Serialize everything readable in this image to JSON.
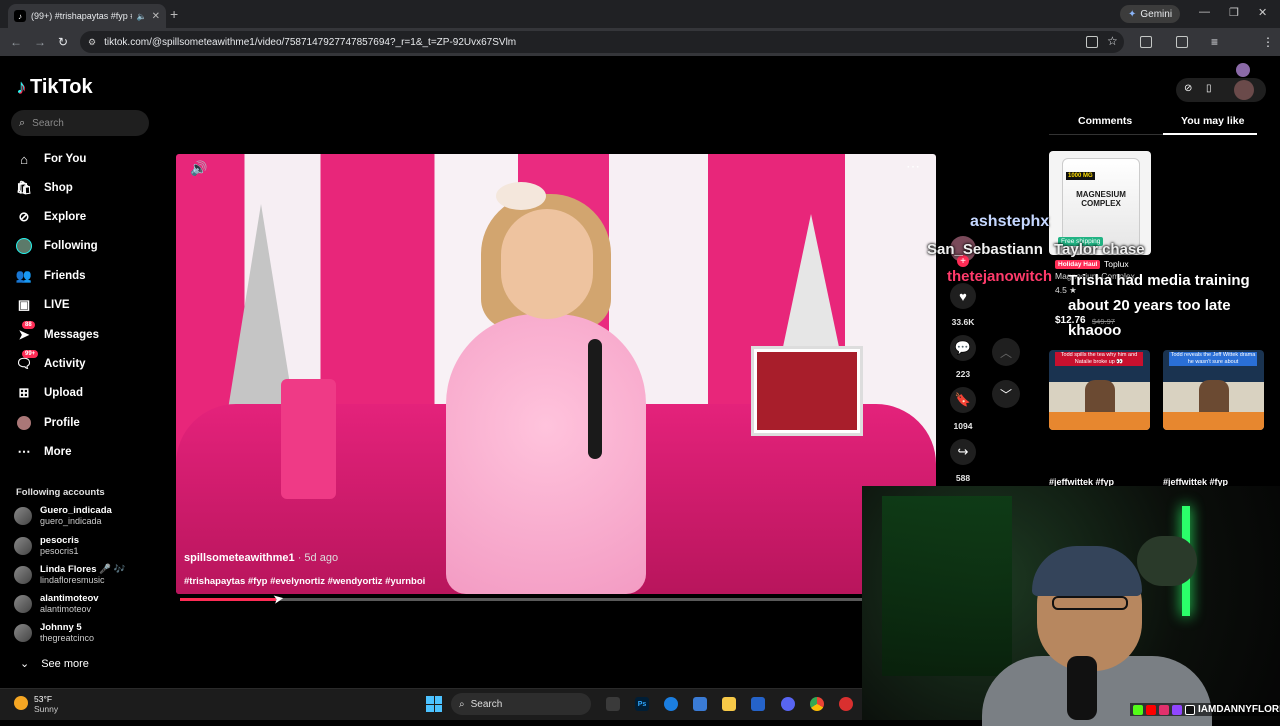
{
  "browser": {
    "tab_title": "(99+) #trishapaytas #fyp #e…",
    "new_tab": "+",
    "gemini_label": "Gemini",
    "url": "tiktok.com/@spillsometeawithme1/video/7587147927747857694?_r=1&_t=ZP-92Uvx67SVlm"
  },
  "sidebar": {
    "logo": "TikTok",
    "search_placeholder": "Search",
    "nav": [
      {
        "label": "For You",
        "icon": "home-icon"
      },
      {
        "label": "Shop",
        "icon": "shop-icon"
      },
      {
        "label": "Explore",
        "icon": "compass-icon"
      },
      {
        "label": "Following",
        "icon": "following-icon"
      },
      {
        "label": "Friends",
        "icon": "friends-icon"
      },
      {
        "label": "LIVE",
        "icon": "live-icon"
      },
      {
        "label": "Messages",
        "icon": "messages-icon",
        "badge": "88"
      },
      {
        "label": "Activity",
        "icon": "activity-icon",
        "badge": "99+"
      },
      {
        "label": "Upload",
        "icon": "upload-icon"
      },
      {
        "label": "Profile",
        "icon": "profile-icon"
      },
      {
        "label": "More",
        "icon": "more-icon"
      }
    ],
    "following_title": "Following accounts",
    "accounts": [
      {
        "name": "Guero_indicada",
        "handle": "guero_indicada"
      },
      {
        "name": "pesocris",
        "handle": "pesocris1"
      },
      {
        "name": "Linda Flores 🎤 🎶",
        "handle": "lindafloresmusic"
      },
      {
        "name": "alantimoteov",
        "handle": "alantimoteov"
      },
      {
        "name": "Johnny 5",
        "handle": "thegreatcinco"
      }
    ],
    "see_more": "See more"
  },
  "video": {
    "author": "spillsometeawithme1",
    "age": " · 5d ago",
    "hashtags": "#trishapaytas #fyp #evelynortiz #wendyortiz #yurnboi",
    "progress": 0.14
  },
  "actions": {
    "likes": "33.6K",
    "comments": "223",
    "saves": "1094",
    "shares": "588"
  },
  "overlay_chat": {
    "name1": "ashstephx",
    "name2": "San_Sebastiann",
    "name3": "Taylor chase",
    "name4": "thetejanowitch",
    "message": "Trisha had media training about 20 years too late",
    "name5": "khaooo"
  },
  "right_panel": {
    "tab_comments": "Comments",
    "tab_you_may_like": "You may like",
    "product": {
      "badge_count": "1000 MG",
      "label": "MAGNESIUM COMPLEX",
      "free_shipping": "Free shipping",
      "holiday": "Holiday Haul",
      "brand": "Toplux",
      "name": "Magnesium Complex",
      "rating": "4.5 ★",
      "price": "$12.76",
      "old_price": "$49.97"
    },
    "thumbs": [
      {
        "caption": "Todd spills the tea why him and Natalie broke up 👀",
        "title": "#jeffwittek #fyp"
      },
      {
        "caption": "Todd reveals the Jeff Wittek drama he wasn't sure about",
        "title": "#jeffwittek #fyp"
      }
    ]
  },
  "webcam": {
    "handle": "IAMDANNYFLORES"
  },
  "taskbar": {
    "temp": "53°F",
    "condition": "Sunny",
    "search": "Search"
  },
  "colors": {
    "accent": "#fe2c55",
    "bg": "#000000",
    "chrome": "#35363a"
  }
}
